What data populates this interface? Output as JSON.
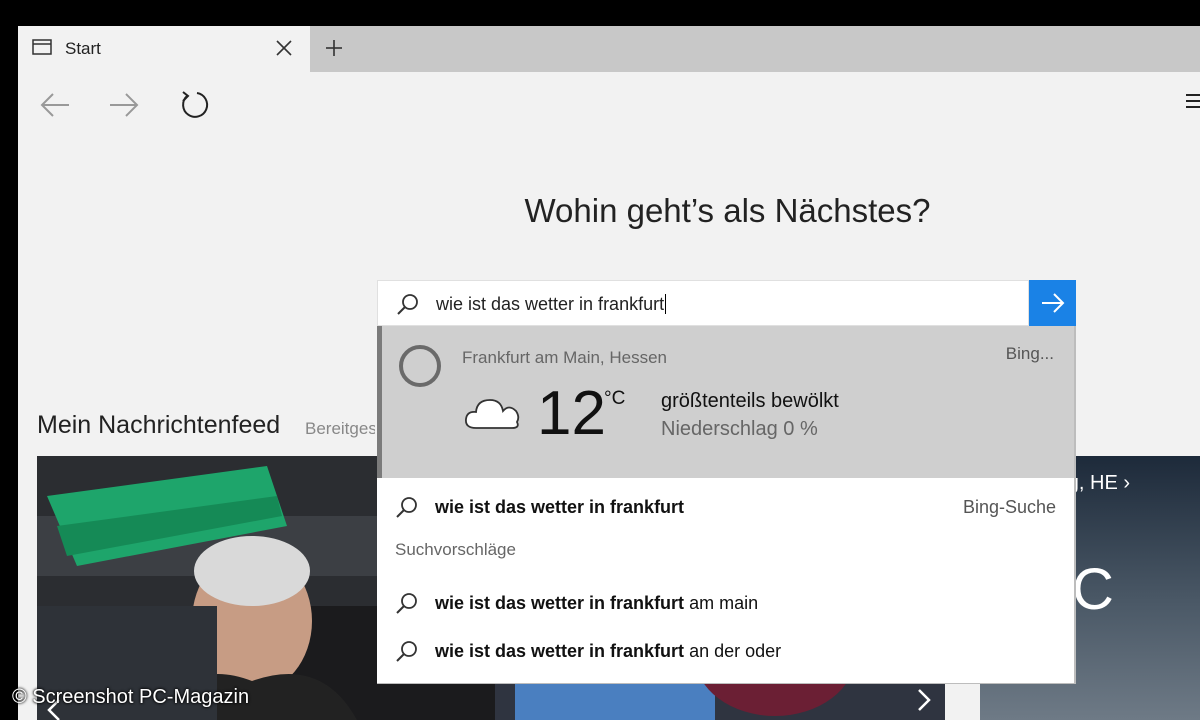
{
  "browser": {
    "tab_title": "Start",
    "menu_icon": "hamburger-icon"
  },
  "page": {
    "heading": "Wohin geht’s als Nächstes?",
    "feed_title": "Mein Nachrichtenfeed",
    "feed_sub": "Bereitgestellt"
  },
  "search": {
    "value": "wie ist das wetter in frankfurt",
    "accent": "#1a82e6"
  },
  "weather_result": {
    "location": "Frankfurt am Main, Hessen",
    "source": "Bing...",
    "temp": "12",
    "unit": "°C",
    "condition": "größtenteils bewölkt",
    "precip": "Niederschlag 0 %"
  },
  "suggestions": {
    "top": {
      "bold": "wie ist das wetter in frankfurt",
      "rest": "",
      "right": "Bing-Suche"
    },
    "section_label": "Suchvorschläge",
    "items": [
      {
        "bold": "wie ist das wetter in frankfurt",
        "rest": " am main"
      },
      {
        "bold": "wie ist das wetter in frankfurt",
        "rest": " an der oder"
      }
    ]
  },
  "weather_card": {
    "location": "erg, HE",
    "temp": "C"
  },
  "watermark": "© Screenshot PC-Magazin"
}
